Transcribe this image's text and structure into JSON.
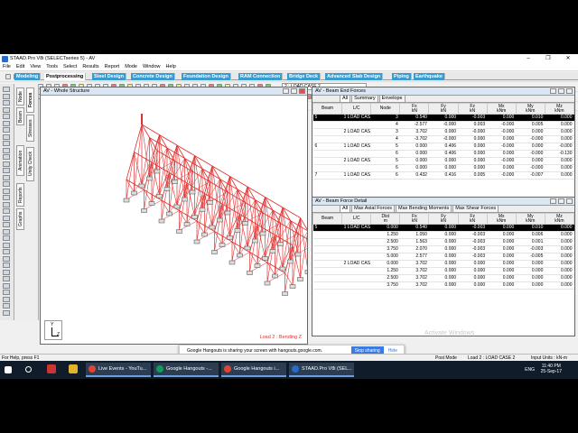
{
  "window": {
    "title": "STAAD.Pro V8i (SELECTseries 5) - AV"
  },
  "menu": [
    "File",
    "Edit",
    "View",
    "Tools",
    "Select",
    "Results",
    "Report",
    "Mode",
    "Window",
    "Help"
  ],
  "toolbar": {
    "load_combo": "2 : LOAD CASE 2"
  },
  "page_tabs": [
    "Modeling",
    "Postprocessing",
    "Steel Design",
    "Concrete Design",
    "Foundation Design",
    "RAM Connection",
    "Bridge Deck",
    "Advanced Slab Design",
    "Piping",
    "Earthquake"
  ],
  "active_page_tab": "Postprocessing",
  "side_tabs": [
    "Node",
    "Beam",
    "Forces",
    "Stresses",
    "Animation",
    "Unity Check",
    "Reports",
    "Graphs"
  ],
  "view3d": {
    "title": "AV - Whole Structure",
    "load_label": "Load 2 : Bending Z",
    "axis_y": "Y",
    "axis_z": "Z"
  },
  "panel1": {
    "title": "AV - Beam End Forces",
    "tabs": [
      "All",
      "Summary",
      "Envelope"
    ],
    "columns": [
      "Beam",
      "L/C",
      "Node",
      "Fx\nkN",
      "Fy\nkN",
      "Fz\nkN",
      "Mx\nkNm",
      "My\nkNm",
      "Mz\nkNm"
    ],
    "rows": [
      [
        "5",
        "1 LOAD CAS",
        "3",
        "0.540",
        "0.000",
        "-0.003",
        "0.000",
        "0.010",
        "0.000"
      ],
      [
        "",
        "",
        "4",
        "-2.577",
        "-0.000",
        "0.003",
        "-0.000",
        "0.005",
        "0.000"
      ],
      [
        "",
        "2 LOAD CAS",
        "3",
        "3.702",
        "0.000",
        "-0.000",
        "-0.000",
        "0.000",
        "0.000"
      ],
      [
        "",
        "",
        "4",
        "-3.702",
        "-0.000",
        "0.000",
        "0.000",
        "-0.000",
        "0.000"
      ],
      [
        "6",
        "1 LOAD CAS",
        "5",
        "0.000",
        "0.406",
        "0.000",
        "-0.000",
        "0.000",
        "-0.000"
      ],
      [
        "",
        "",
        "6",
        "0.000",
        "0.406",
        "0.000",
        "0.000",
        "-0.000",
        "-0.130"
      ],
      [
        "",
        "2 LOAD CAS",
        "5",
        "0.000",
        "0.000",
        "0.000",
        "-0.000",
        "0.000",
        "0.000"
      ],
      [
        "",
        "",
        "6",
        "0.000",
        "0.000",
        "0.000",
        "0.000",
        "-0.000",
        "0.000"
      ],
      [
        "7",
        "1 LOAD CAS",
        "6",
        "0.432",
        "0.416",
        "0.005",
        "-0.000",
        "-0.007",
        "0.000"
      ]
    ]
  },
  "panel2": {
    "title": "AV - Beam Force Detail",
    "tabs": [
      "All",
      "Max Axial Forces",
      "Max Bending Moments",
      "Max Shear Forces"
    ],
    "columns": [
      "Beam",
      "L/C",
      "Dist\nm",
      "Fx\nkN",
      "Fy\nkN",
      "Fz\nkN",
      "Mx\nkNm",
      "My\nkNm",
      "Mz\nkNm"
    ],
    "rows": [
      [
        "5",
        "1 LOAD CAS",
        "0.000",
        "0.540",
        "0.000",
        "-0.003",
        "0.000",
        "0.010",
        "0.000"
      ],
      [
        "",
        "",
        "1.250",
        "1.050",
        "0.000",
        "-0.003",
        "0.000",
        "0.006",
        "0.000"
      ],
      [
        "",
        "",
        "2.500",
        "1.563",
        "0.000",
        "-0.003",
        "0.000",
        "0.001",
        "0.000"
      ],
      [
        "",
        "",
        "3.750",
        "2.070",
        "0.000",
        "-0.003",
        "0.000",
        "-0.003",
        "0.000"
      ],
      [
        "",
        "",
        "5.000",
        "2.577",
        "0.000",
        "-0.003",
        "0.000",
        "-0.005",
        "0.000"
      ],
      [
        "",
        "2 LOAD CAS",
        "0.000",
        "3.702",
        "0.000",
        "0.000",
        "0.000",
        "0.000",
        "0.000"
      ],
      [
        "",
        "",
        "1.250",
        "3.702",
        "0.000",
        "0.000",
        "0.000",
        "0.000",
        "0.000"
      ],
      [
        "",
        "",
        "2.500",
        "3.702",
        "0.000",
        "0.000",
        "0.000",
        "0.000",
        "0.000"
      ],
      [
        "",
        "",
        "3.750",
        "3.702",
        "0.000",
        "0.000",
        "0.000",
        "0.000",
        "0.000"
      ]
    ]
  },
  "hangouts": {
    "text": "Google Hangouts is sharing your screen with hangouts.google.com.",
    "stop": "Stop sharing",
    "hide": "Hide"
  },
  "watermark": "Activate Windows",
  "status": {
    "left": "For Help, press F1",
    "mode": "Post Mode",
    "load": "Load 2 : LOAD CASE 2",
    "units": "Input Units : kN-m"
  },
  "taskbar": {
    "apps": [
      "Live Events - YouTu...",
      "Google Hangouts -...",
      "Google Hangouts i...",
      "STAAD.Pro V8i (SEL..."
    ],
    "lang": "ENG",
    "time": "11:40 PM",
    "date": "25-Sep-17"
  },
  "colors": {
    "structure": "#e03030",
    "tab_blue": "#3a9bd0",
    "taskbar": "#101c2a"
  }
}
